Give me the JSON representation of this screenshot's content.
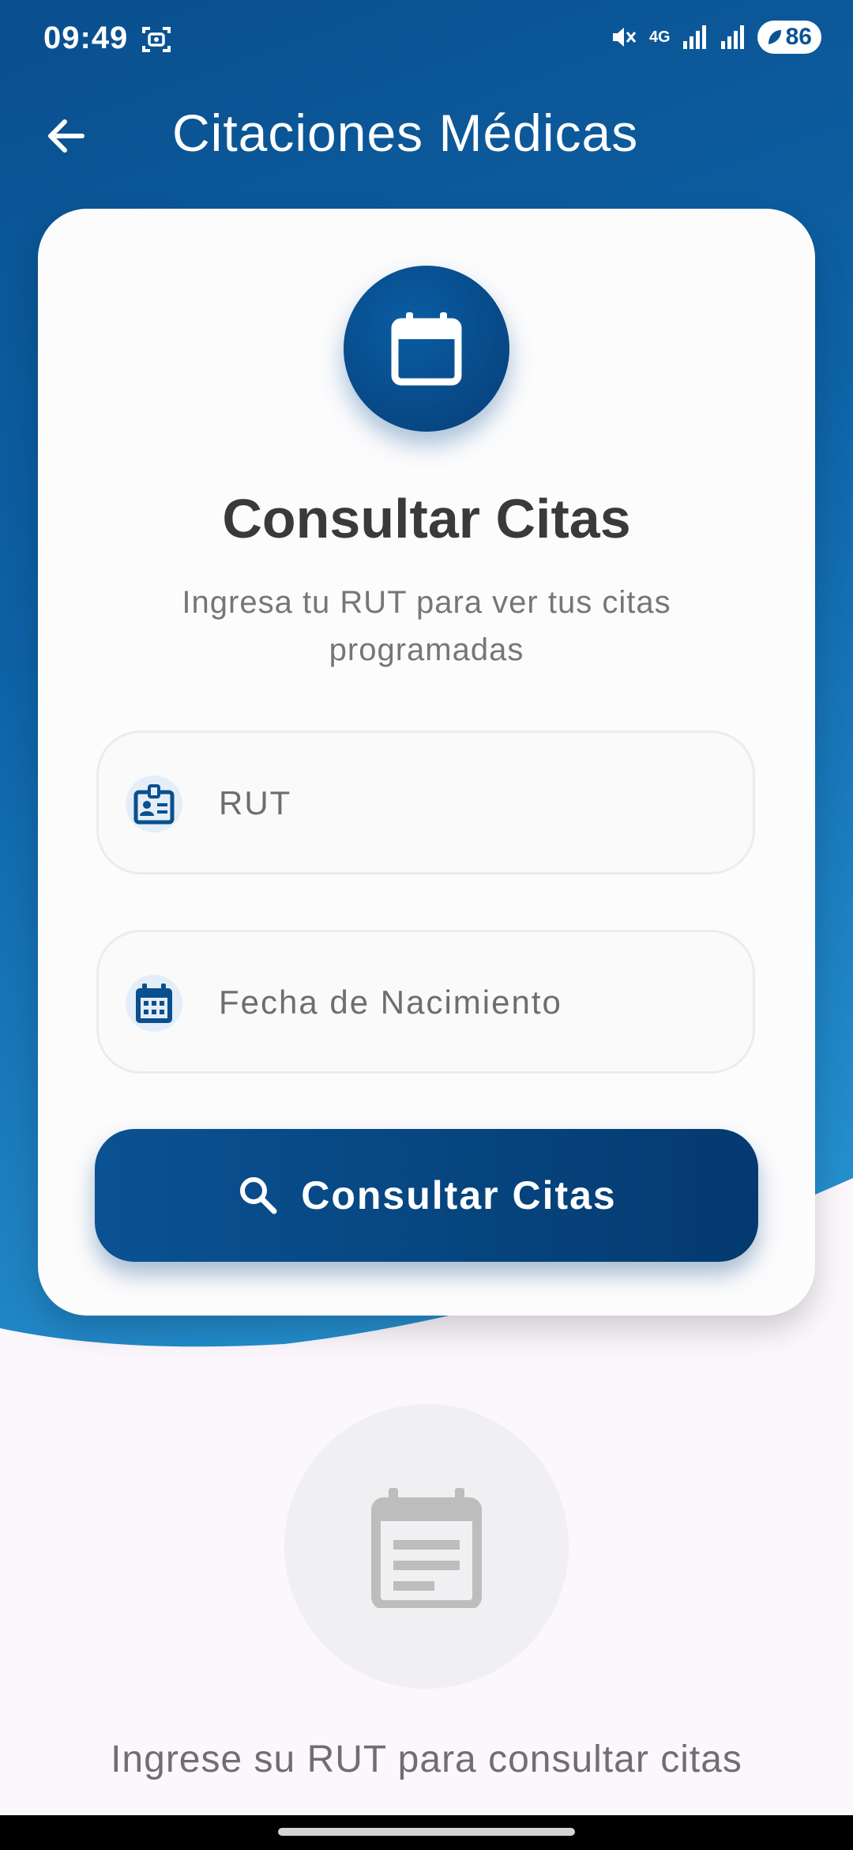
{
  "status_bar": {
    "time": "09:49",
    "network_label": "4G",
    "battery_level": "86"
  },
  "app_bar": {
    "title": "Citaciones Médicas"
  },
  "card": {
    "title": "Consultar Citas",
    "subtitle": "Ingresa tu RUT para ver tus citas programadas",
    "rut_field": {
      "placeholder": "RUT",
      "value": ""
    },
    "birthdate_field": {
      "placeholder": "Fecha de Nacimiento",
      "value": ""
    },
    "submit_label": "Consultar Citas"
  },
  "empty_state": {
    "message": "Ingrese su RUT para consultar citas"
  },
  "colors": {
    "primary": "#0a5293",
    "primary_dark": "#043a6f",
    "header_gradient_end": "#2a98d6",
    "background": "#fbf7fd"
  },
  "icons": [
    "screen-record-icon",
    "mute-icon",
    "signal-icon",
    "battery-icon",
    "back-arrow-icon",
    "calendar-icon",
    "id-card-icon",
    "calendar-grid-icon",
    "search-icon",
    "document-calendar-icon"
  ]
}
